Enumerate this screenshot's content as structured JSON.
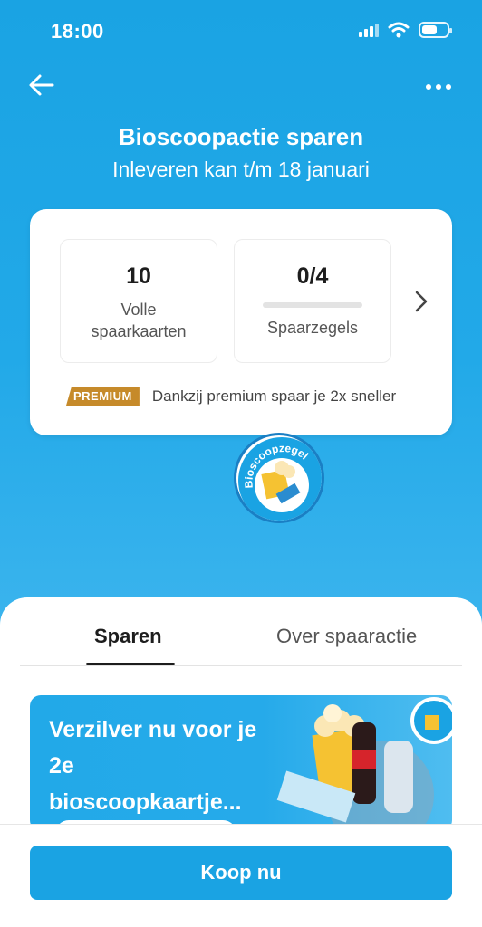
{
  "status_bar": {
    "time": "18:00"
  },
  "header": {
    "title": "Bioscoopactie sparen",
    "subtitle": "Inleveren kan t/m 18 januari"
  },
  "summary": {
    "full_cards": {
      "value": "10",
      "label": "Volle spaarkaarten"
    },
    "stamps": {
      "value": "0/4",
      "label": "Spaarzegels",
      "progress": 0
    },
    "premium_badge": "PREMIUM",
    "premium_text": "Dankzij premium spaar je 2x sneller"
  },
  "stamp_logo": {
    "text": "Bioscoopzegel"
  },
  "tabs": [
    {
      "label": "Sparen",
      "active": true
    },
    {
      "label": "Over spaaractie",
      "active": false
    }
  ],
  "promo": {
    "text": "Verzilver nu voor je 2e bioscoopkaartje..."
  },
  "footer": {
    "buy_label": "Koop nu"
  },
  "colors": {
    "brand": "#1aa3e3",
    "premium": "#c68a2a"
  }
}
